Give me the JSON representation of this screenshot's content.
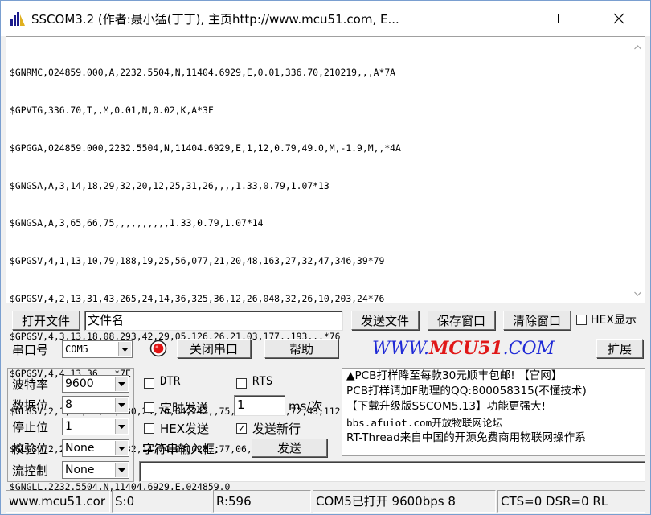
{
  "window": {
    "title": "SSCOM3.2 (作者:聂小猛(丁丁), 主页http://www.mcu51.com,  E...",
    "controls": {
      "minimize": "minimize",
      "maximize": "maximize",
      "close": "close"
    }
  },
  "log": {
    "lines": [
      "$GNRMC,024859.000,A,2232.5504,N,11404.6929,E,0.01,336.70,210219,,,A*7A",
      "$GPVTG,336.70,T,,M,0.01,N,0.02,K,A*3F",
      "$GPGGA,024859.000,2232.5504,N,11404.6929,E,1,12,0.79,49.0,M,-1.9,M,,*4A",
      "$GNGSA,A,3,14,18,29,32,20,12,25,31,26,,,,1.33,0.79,1.07*13",
      "$GNGSA,A,3,65,66,75,,,,,,,,,,1.33,0.79,1.07*14",
      "$GPGSV,4,1,13,10,79,188,19,25,56,077,21,20,48,163,27,32,47,346,39*79",
      "$GPGSV,4,2,13,31,43,265,24,14,36,325,36,12,26,048,32,26,10,203,24*76",
      "$GPGSV,4,3,13,18,08,293,42,29,05,126,26,21,03,177,,193,,,*76",
      "$GPGSV,4,4,13,36,,,*7E",
      "$GLGSV,2,1,07,65,64,030,29,76,64,242,,75,60,010,32,72,43,112,*6B",
      "$GLGSV,2,2,07,66,16,332,11,74,08,028,,77,06,217,*54",
      "$GNGLL,2232.5504,N,11404.6929,E,024859.0"
    ]
  },
  "toolbar1": {
    "open_file": "打开文件",
    "filename_value": "文件名",
    "send_file": "发送文件",
    "save_window": "保存窗口",
    "clear_window": "清除窗口",
    "hex_display": "HEX显示"
  },
  "toolbar2": {
    "port_label": "串口号",
    "port_value": "COM5",
    "close_port": "关闭串口",
    "help": "帮助",
    "brand_part1": "WWW.",
    "brand_part2": "MCU51",
    "brand_part3": ".COM",
    "expand": "扩展"
  },
  "settings": {
    "baud_label": "波特率",
    "baud_value": "9600",
    "data_bits_label": "数据位",
    "data_bits_value": "8",
    "stop_bits_label": "停止位",
    "stop_bits_value": "1",
    "parity_label": "校验位",
    "parity_value": "None",
    "flow_label": "流控制",
    "flow_value": "None"
  },
  "options": {
    "dtr": "DTR",
    "rts": "RTS",
    "timed_send": "定时发送",
    "interval_value": "1",
    "interval_unit": "ms/次",
    "hex_send": "HEX发送",
    "send_newline": "发送新行",
    "send_newline_checked": "✓",
    "input_label": "字符串输入框:",
    "send_button": "发送",
    "send_input_value": ""
  },
  "notice": {
    "line1": "▲PCB打样降至每款30元顺丰包邮! 【官网】",
    "line2": "PCB打样请加F助理的QQ:800058315(不懂技术)",
    "line3": "【下载升级版SSCOM5.13】功能更强大!",
    "line4": "bbs.afuiot.com开放物联网论坛",
    "line5": "RT-Thread来自中国的开源免费商用物联网操作系"
  },
  "status": {
    "site": "www.mcu51.cor",
    "sent": "S:0",
    "received": "R:596",
    "port_state": "COM5已打开  9600bps  8",
    "lines": "CTS=0 DSR=0 RL"
  }
}
